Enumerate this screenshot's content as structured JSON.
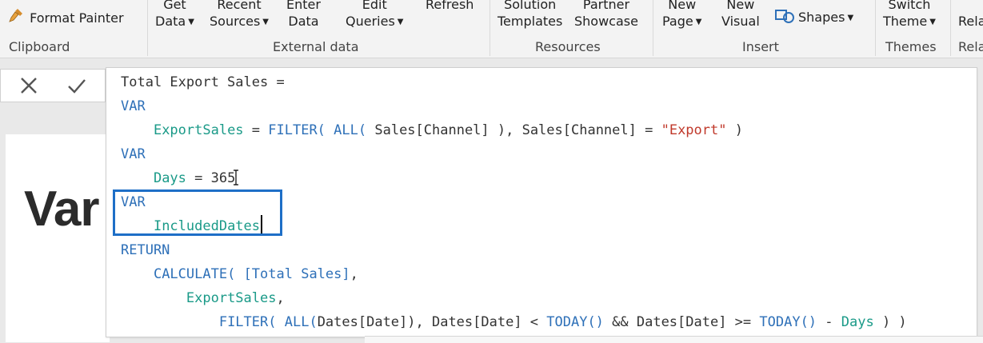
{
  "ribbon": {
    "clipboard": {
      "format_painter": "Format Painter",
      "group_label": "Clipboard"
    },
    "external_data": {
      "get_data": [
        "Get",
        "Data"
      ],
      "recent_sources": [
        "Recent",
        "Sources"
      ],
      "enter_data": [
        "Enter",
        "Data"
      ],
      "edit_queries": [
        "Edit",
        "Queries"
      ],
      "refresh": [
        "Refresh",
        ""
      ],
      "group_label": "External data"
    },
    "resources": {
      "solution_templates": [
        "Solution",
        "Templates"
      ],
      "partner_showcase": [
        "Partner",
        "Showcase"
      ],
      "group_label": "Resources"
    },
    "insert": {
      "new_page": [
        "New",
        "Page"
      ],
      "new_visual": [
        "New",
        "Visual"
      ],
      "shapes": "Shapes",
      "group_label": "Insert"
    },
    "themes": {
      "switch_theme": [
        "Switch",
        "Theme"
      ],
      "group_label": "Themes"
    },
    "relationships": {
      "manage": [
        "",
        "Rela"
      ],
      "group_label": "Rela"
    }
  },
  "formula_bar": {
    "cancel_icon": "close-icon",
    "commit_icon": "check-icon"
  },
  "canvas": {
    "title_partial": "Var"
  },
  "editor": {
    "lines": [
      [
        {
          "t": "Total Export Sales =",
          "c": "txt"
        }
      ],
      [
        {
          "t": "VAR",
          "c": "kw"
        }
      ],
      [
        {
          "t": "    ",
          "c": "txt"
        },
        {
          "t": "ExportSales",
          "c": "var"
        },
        {
          "t": " = ",
          "c": "txt"
        },
        {
          "t": "FILTER(",
          "c": "fn"
        },
        {
          "t": " ",
          "c": "txt"
        },
        {
          "t": "ALL(",
          "c": "fn"
        },
        {
          "t": " Sales[Channel] ), Sales[Channel] = ",
          "c": "txt"
        },
        {
          "t": "\"Export\"",
          "c": "str"
        },
        {
          "t": " )",
          "c": "txt"
        }
      ],
      [
        {
          "t": "VAR",
          "c": "kw"
        }
      ],
      [
        {
          "t": "    ",
          "c": "txt"
        },
        {
          "t": "Days",
          "c": "var"
        },
        {
          "t": " = 365",
          "c": "txt"
        }
      ],
      [
        {
          "t": "VAR",
          "c": "kw"
        }
      ],
      [
        {
          "t": "    ",
          "c": "txt"
        },
        {
          "t": "IncludedDates",
          "c": "var"
        }
      ],
      [
        {
          "t": "RETURN",
          "c": "kw"
        }
      ],
      [
        {
          "t": "    ",
          "c": "txt"
        },
        {
          "t": "CALCULATE(",
          "c": "fn"
        },
        {
          "t": " ",
          "c": "txt"
        },
        {
          "t": "[Total Sales]",
          "c": "kw"
        },
        {
          "t": ",",
          "c": "txt"
        }
      ],
      [
        {
          "t": "        ",
          "c": "txt"
        },
        {
          "t": "ExportSales",
          "c": "var"
        },
        {
          "t": ",",
          "c": "txt"
        }
      ],
      [
        {
          "t": "            ",
          "c": "txt"
        },
        {
          "t": "FILTER(",
          "c": "fn"
        },
        {
          "t": " ",
          "c": "txt"
        },
        {
          "t": "ALL(",
          "c": "fn"
        },
        {
          "t": "Dates[Date]), Dates[Date] < ",
          "c": "txt"
        },
        {
          "t": "TODAY()",
          "c": "fn"
        },
        {
          "t": " && Dates[Date] >= ",
          "c": "txt"
        },
        {
          "t": "TODAY()",
          "c": "fn"
        },
        {
          "t": " - ",
          "c": "txt"
        },
        {
          "t": "Days",
          "c": "var"
        },
        {
          "t": " ) )",
          "c": "txt"
        }
      ]
    ],
    "caret_line": 6,
    "ibeam_line": 4,
    "colors": {
      "keyword": "#2e70b8",
      "variable": "#1a9a88",
      "string": "#c0392b",
      "text": "#333333",
      "highlight": "#1e6fc7"
    }
  }
}
